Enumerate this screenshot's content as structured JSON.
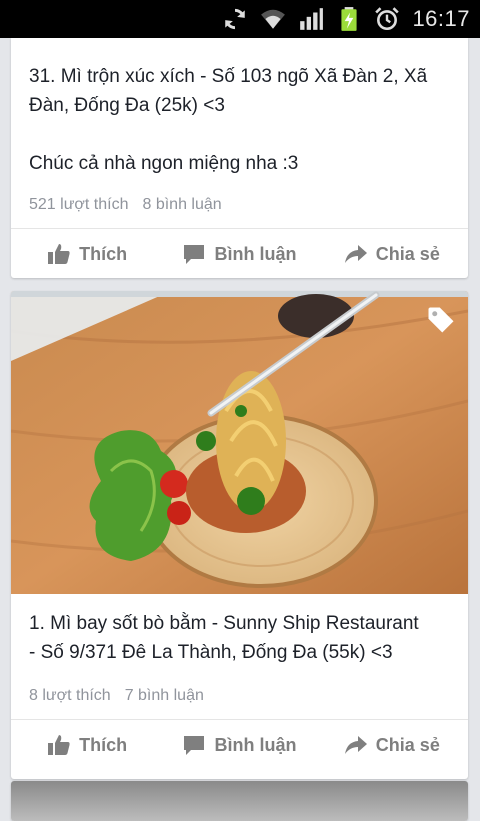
{
  "status_bar": {
    "time": "16:17",
    "icons": [
      "sync-icon",
      "wifi-icon",
      "signal-icon",
      "battery-charging-icon",
      "alarm-icon"
    ]
  },
  "posts": [
    {
      "text_line1": "31. Mì trộn xúc xích - Số 103 ngõ Xã Đàn 2, Xã",
      "text_line2": "Đàn, Đống Đa (25k) <3",
      "text_line3": "Chúc cả nhà ngon miệng nha :3",
      "likes": "521 lượt thích",
      "comments": "8 bình luận"
    },
    {
      "photo_icon": "tag-icon",
      "text_line1": "1. Mì bay sốt bò bằm - Sunny Ship Restaurant",
      "text_line2": "- Số 9/371 Đê La Thành, Đống Đa (55k) <3",
      "likes": "8 lượt thích",
      "comments": "7 bình luận"
    }
  ],
  "actions": {
    "like": "Thích",
    "comment": "Bình luận",
    "share": "Chia sẻ"
  },
  "colors": {
    "background": "#e4e6ea",
    "card": "#ffffff",
    "text": "#1d2129",
    "meta": "#90949c",
    "action": "#7f7f7f"
  }
}
